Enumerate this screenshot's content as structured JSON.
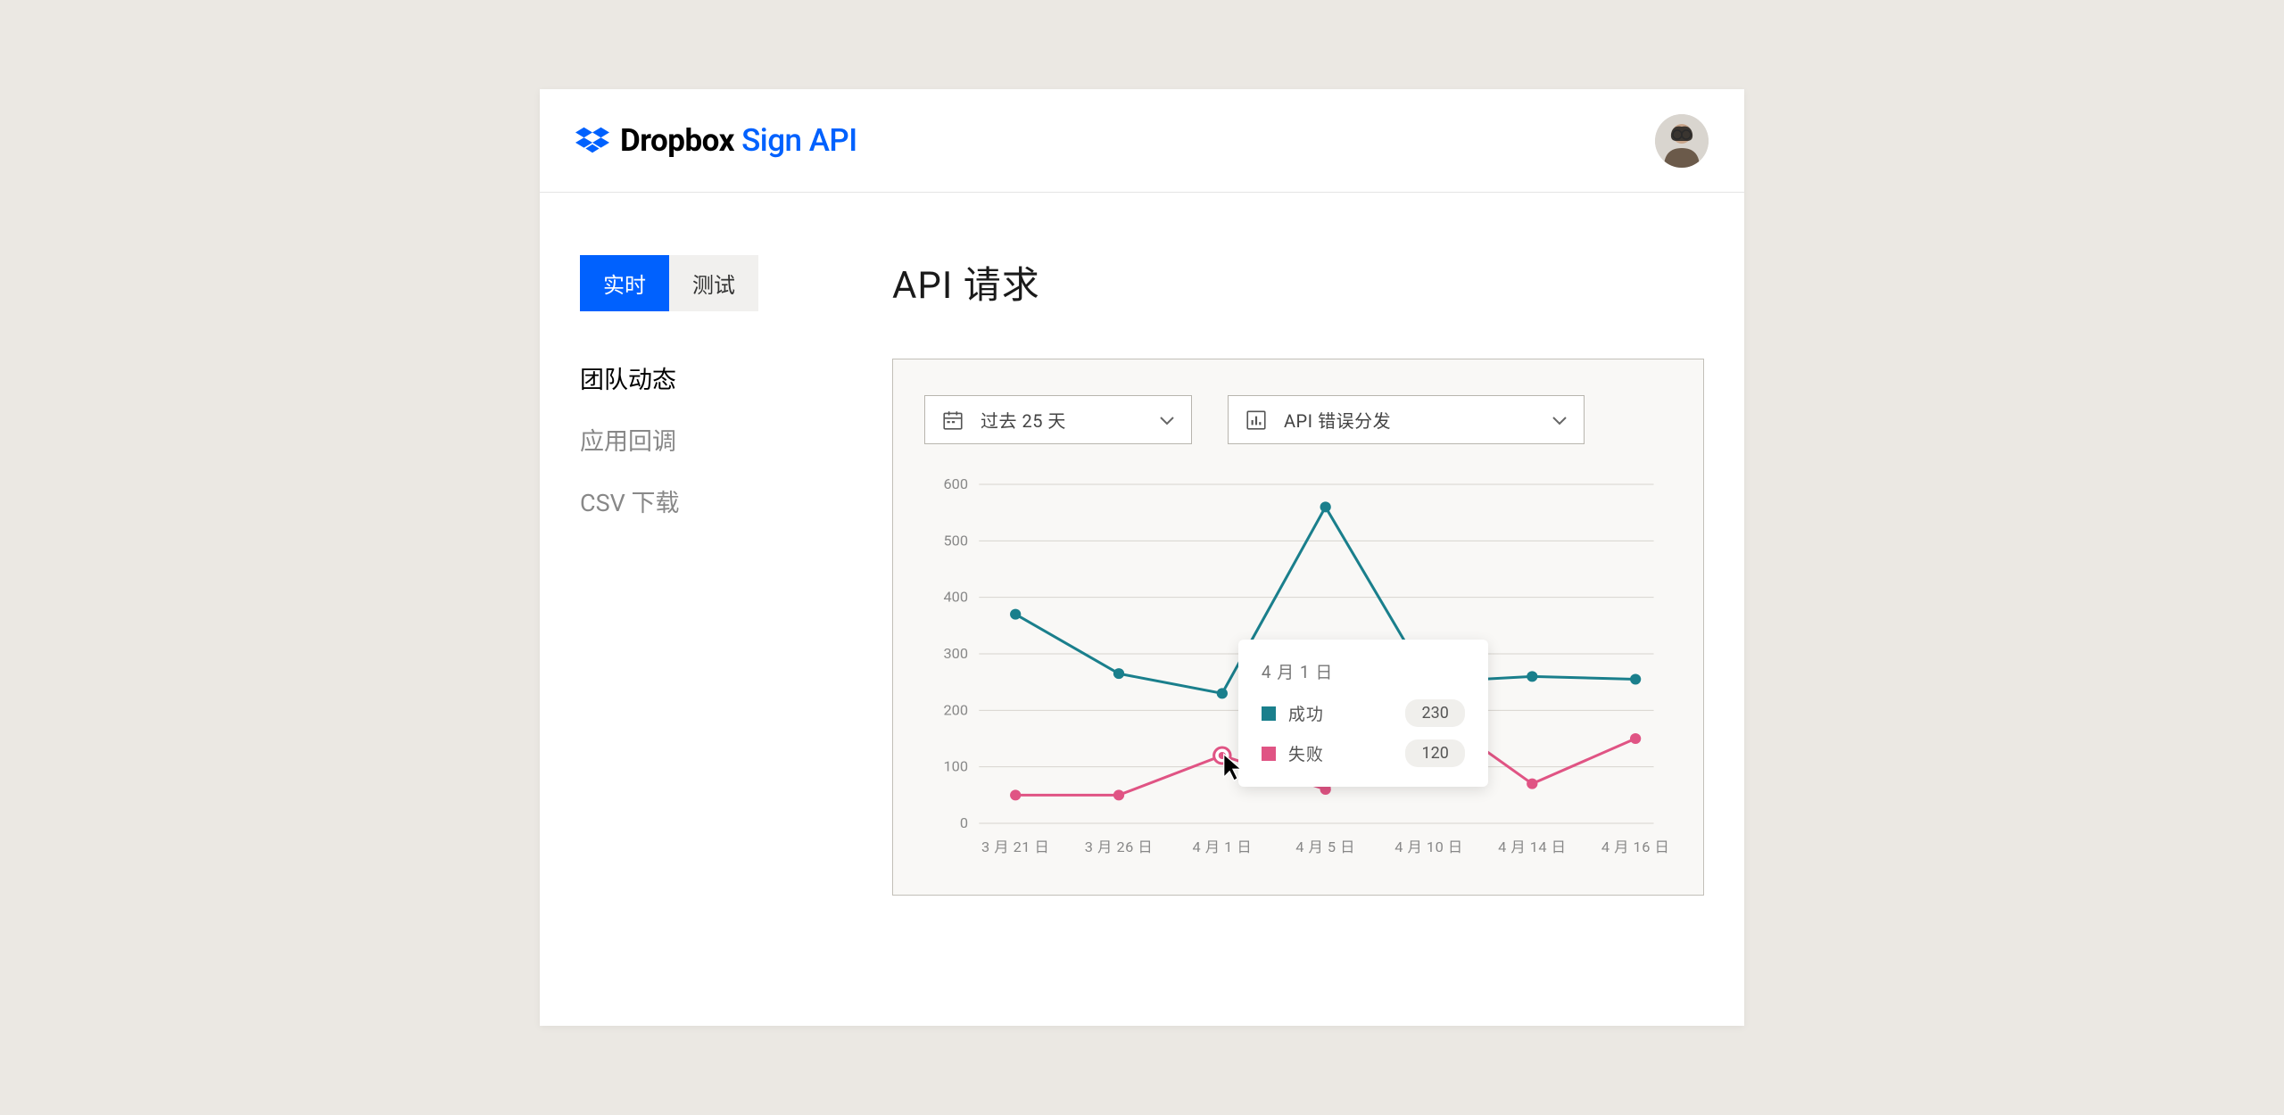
{
  "brand": {
    "part1": "Dropbox",
    "part2": "Sign",
    "part3": "API"
  },
  "tabs": {
    "live": "实时",
    "test": "测试"
  },
  "nav": {
    "team_activity": "团队动态",
    "app_callbacks": "应用回调",
    "csv_download": "CSV 下载"
  },
  "page_title": "API 请求",
  "dropdowns": {
    "range": "过去 25 天",
    "metric": "API 错误分发"
  },
  "tooltip": {
    "title": "4 月 1 日",
    "success_label": "成功",
    "success_value": "230",
    "fail_label": "失败",
    "fail_value": "120"
  },
  "colors": {
    "primary": "#0061fe",
    "success_series": "#1a7f8c",
    "fail_series": "#e05484"
  },
  "chart_data": {
    "type": "line",
    "title": "API 请求",
    "xlabel": "",
    "ylabel": "",
    "ylim": [
      0,
      600
    ],
    "y_ticks": [
      0,
      100,
      200,
      300,
      400,
      500,
      600
    ],
    "categories": [
      "3 月 21 日",
      "3 月 26 日",
      "4 月 1 日",
      "4 月 5 日",
      "4 月 10 日",
      "4 月 14 日",
      "4 月 16 日"
    ],
    "series": [
      {
        "name": "成功",
        "values": [
          370,
          265,
          230,
          560,
          250,
          260,
          255
        ]
      },
      {
        "name": "失败",
        "values": [
          50,
          50,
          120,
          60,
          200,
          70,
          150
        ]
      }
    ],
    "highlight_index": 2,
    "tooltip": {
      "category": "4 月 1 日",
      "rows": [
        {
          "label": "成功",
          "value": 230
        },
        {
          "label": "失败",
          "value": 120
        }
      ]
    }
  }
}
